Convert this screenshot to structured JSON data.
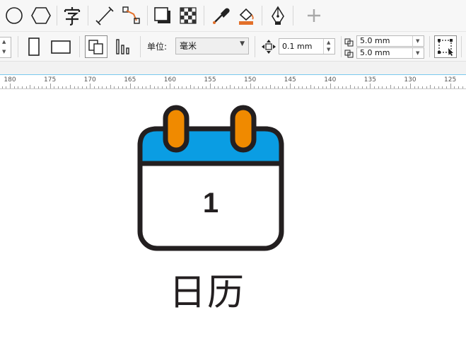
{
  "property_bar": {
    "unit_label": "单位:",
    "unit_value": "毫米",
    "nudge_value": "0.1 mm",
    "duplicate_x": "5.0 mm",
    "duplicate_y": "5.0 mm"
  },
  "ruler": {
    "labels": [
      "180",
      "175",
      "170",
      "165",
      "160",
      "155",
      "150",
      "145",
      "140",
      "135",
      "130",
      "125"
    ]
  },
  "canvas": {
    "calendar_day": "1",
    "caption": "日历"
  },
  "colors": {
    "calendar_header": "#0a9de3",
    "calendar_rings": "#f08a00",
    "outline": "#231f20"
  }
}
